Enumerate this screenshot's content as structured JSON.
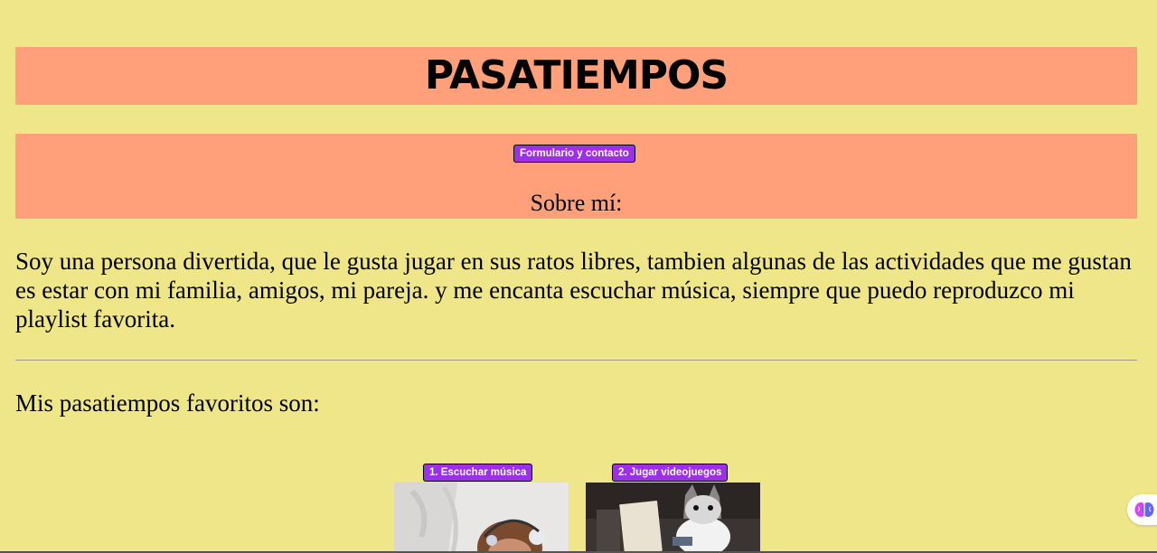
{
  "header": {
    "title": "PASATIEMPOS"
  },
  "nav": {
    "contact_button_label": "Formulario y contacto",
    "about_heading": "Sobre mí:"
  },
  "about": {
    "bio": "Soy una persona divertida, que le gusta jugar en sus ratos libres, tambien algunas de las actividades que me gustan es estar con mi familia, amigos, mi pareja. y me encanta escuchar música, siempre que puedo reproduzco mi playlist favorita."
  },
  "hobbies": {
    "intro": "Mis pasatiempos favoritos son:",
    "items": [
      {
        "label": "1. Escuchar música",
        "image": "monkey-with-headphones"
      },
      {
        "label": "2. Jugar videojuegos",
        "image": "cat-playing-game"
      }
    ]
  },
  "widgets": {
    "assistant_icon": "brain-icon"
  },
  "colors": {
    "page_background": "#efe589",
    "band_background": "#ffa07a",
    "button_background": "#9b30e8"
  }
}
